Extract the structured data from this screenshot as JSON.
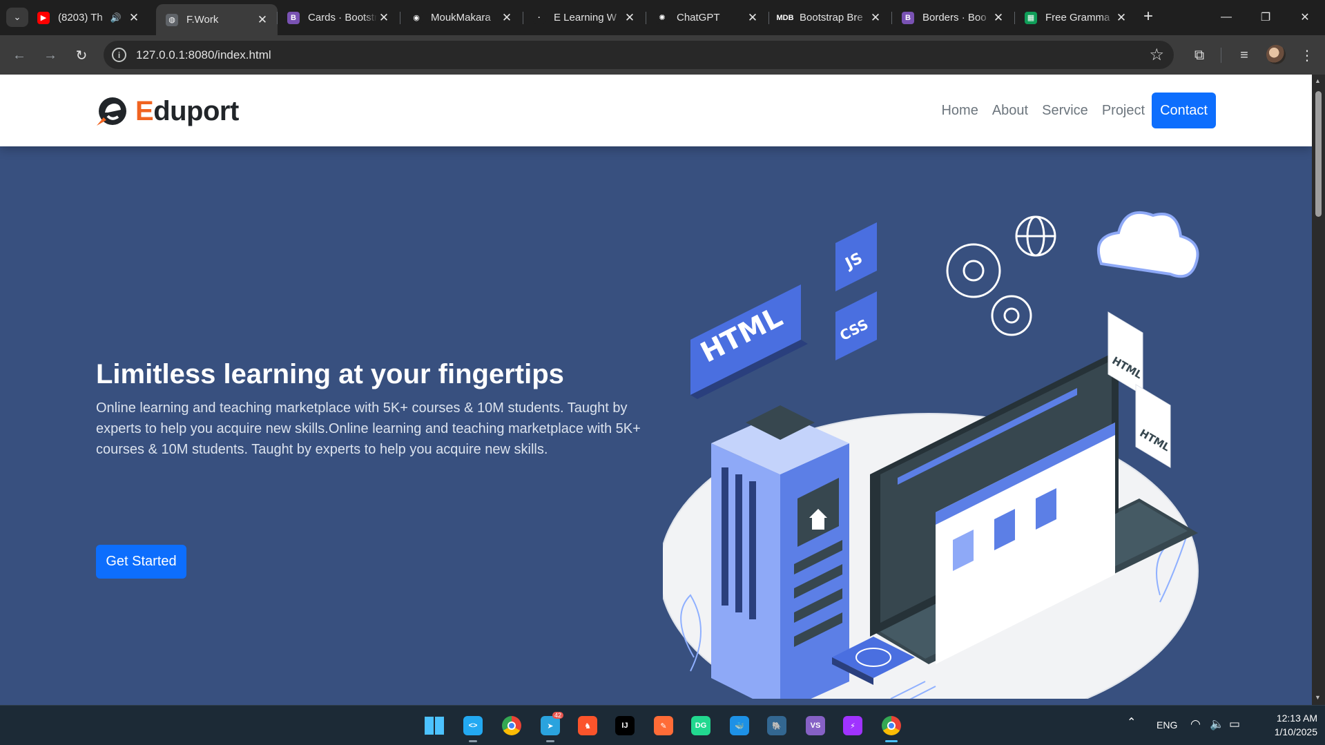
{
  "browser": {
    "tabs": [
      {
        "title": "(8203) Th",
        "icon": "youtube-icon",
        "icon_color": "#ff0000",
        "icon_text": "▶",
        "audio": true
      },
      {
        "title": "F.Work",
        "icon": "globe-icon",
        "icon_color": "#5f6368",
        "icon_text": "◍",
        "active": true
      },
      {
        "title": "Cards · Bootstrap",
        "icon": "bootstrap-icon",
        "icon_color": "#7952b3",
        "icon_text": "B"
      },
      {
        "title": "MoukMakara",
        "icon": "github-icon",
        "icon_color": "#1f1f1f",
        "icon_text": "◉"
      },
      {
        "title": "E Learning W",
        "icon": "dot-icon",
        "icon_color": "#1f1f1f",
        "icon_text": "·"
      },
      {
        "title": "ChatGPT",
        "icon": "chatgpt-icon",
        "icon_color": "#1f1f1f",
        "icon_text": "✺"
      },
      {
        "title": "Bootstrap Bre",
        "icon": "mdb-icon",
        "icon_color": "#1f1f1f",
        "icon_text": "MDB"
      },
      {
        "title": "Borders · Boo",
        "icon": "bootstrap-icon",
        "icon_color": "#7952b3",
        "icon_text": "B"
      },
      {
        "title": "Free Gramma",
        "icon": "sheets-icon",
        "icon_color": "#0f9d58",
        "icon_text": "▦"
      }
    ],
    "url": "127.0.0.1:8080/index.html"
  },
  "site": {
    "brand_initial": "E",
    "brand_rest": "duport",
    "nav": [
      "Home",
      "About",
      "Service",
      "Project"
    ],
    "contact": "Contact",
    "accent": "#0d6efd",
    "brand_color": "#f06320",
    "hero_bg": "#38507f"
  },
  "hero": {
    "title": "Limitless learning at your fingertips",
    "description": "Online learning and teaching marketplace with 5K+ courses & 10M students. Taught by experts to help you acquire new skills.Online learning and teaching marketplace with 5K+ courses & 10M students. Taught by experts to help you acquire new skills.",
    "cta": "Get Started",
    "illustration_labels": {
      "html": "HTML",
      "js": "JS",
      "css": "CSS",
      "file1": "HTML",
      "file2": "HTML",
      "code": "</>"
    }
  },
  "taskbar": {
    "apps": [
      {
        "name": "windows-start-icon"
      },
      {
        "name": "vscode-icon",
        "color": "#23a9f2",
        "text": "<>"
      },
      {
        "name": "chrome-icon"
      },
      {
        "name": "telegram-icon",
        "color": "#2aa3de",
        "text": "➤",
        "badge": "42"
      },
      {
        "name": "brave-icon",
        "color": "#fb542b",
        "text": "♞"
      },
      {
        "name": "intellij-icon",
        "color": "#000000",
        "text": "IJ"
      },
      {
        "name": "postman-icon",
        "color": "#ff6c37",
        "text": "✎"
      },
      {
        "name": "datagrip-icon",
        "color": "#22d88f",
        "text": "DG"
      },
      {
        "name": "docker-icon",
        "color": "#1d91e6",
        "text": "🐳"
      },
      {
        "name": "postgresql-icon",
        "color": "#336791",
        "text": "🐘"
      },
      {
        "name": "visual-studio-icon",
        "color": "#8661c5",
        "text": "VS"
      },
      {
        "name": "messenger-icon",
        "color": "#a033ff",
        "text": "⚡"
      },
      {
        "name": "chrome-profile-icon"
      }
    ],
    "language": "ENG",
    "time": "12:13 AM",
    "date": "1/10/2025"
  }
}
